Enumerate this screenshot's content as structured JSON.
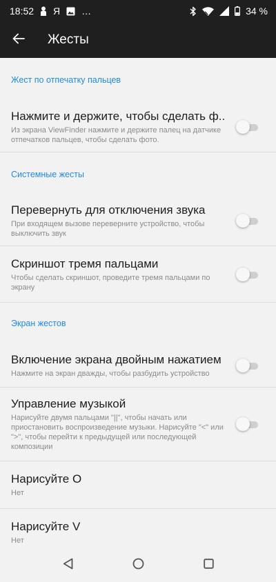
{
  "status_bar": {
    "time": "18:52",
    "ya_label": "Я",
    "dots": "…",
    "battery": "34 %"
  },
  "app_bar": {
    "title": "Жесты"
  },
  "sections": {
    "fingerprint": {
      "header": "Жест по отпечатку пальцев",
      "item": {
        "title": "Нажмите и держите, чтобы сделать ф..",
        "summary": "Из экрана ViewFinder нажмите и держите палец на датчике отпечатков пальцев, чтобы сделать фото.",
        "enabled": false
      }
    },
    "system": {
      "header": "Системные жесты",
      "flip": {
        "title": "Перевернуть для отключения звука",
        "summary": "При входящем вызове переверните устройство, чтобы выключить звук",
        "enabled": false
      },
      "screenshot": {
        "title": "Скриншот тремя пальцами",
        "summary": "Чтобы сделать скриншот, проведите тремя пальцами по экрану",
        "enabled": false
      }
    },
    "screen": {
      "header": "Экран жестов",
      "double_tap": {
        "title": "Включение экрана двойным нажатием",
        "summary": "Нажмите на экран дважды, чтобы разбудить устройство",
        "enabled": false
      },
      "music": {
        "title": "Управление музыкой",
        "summary": "Нарисуйте двумя пальцами \"||\", чтобы начать или приостановить воспроизведение музыки. Нарисуйте \"<\" или \">\", чтобы перейти к предыдущей или последующей композиции",
        "enabled": false
      },
      "draw_o": {
        "title": "Нарисуйте O",
        "summary": "Нет"
      },
      "draw_v": {
        "title": "Нарисуйте V",
        "summary": "Нет"
      }
    }
  },
  "icons": {
    "back": "arrow-left-icon",
    "nav_back": "triangle-back-icon",
    "nav_home": "circle-home-icon",
    "nav_recents": "square-recents-icon"
  },
  "colors": {
    "app_bar": "#1f1f1f",
    "accent": "#1e8be8",
    "background": "#f2f2f2"
  }
}
